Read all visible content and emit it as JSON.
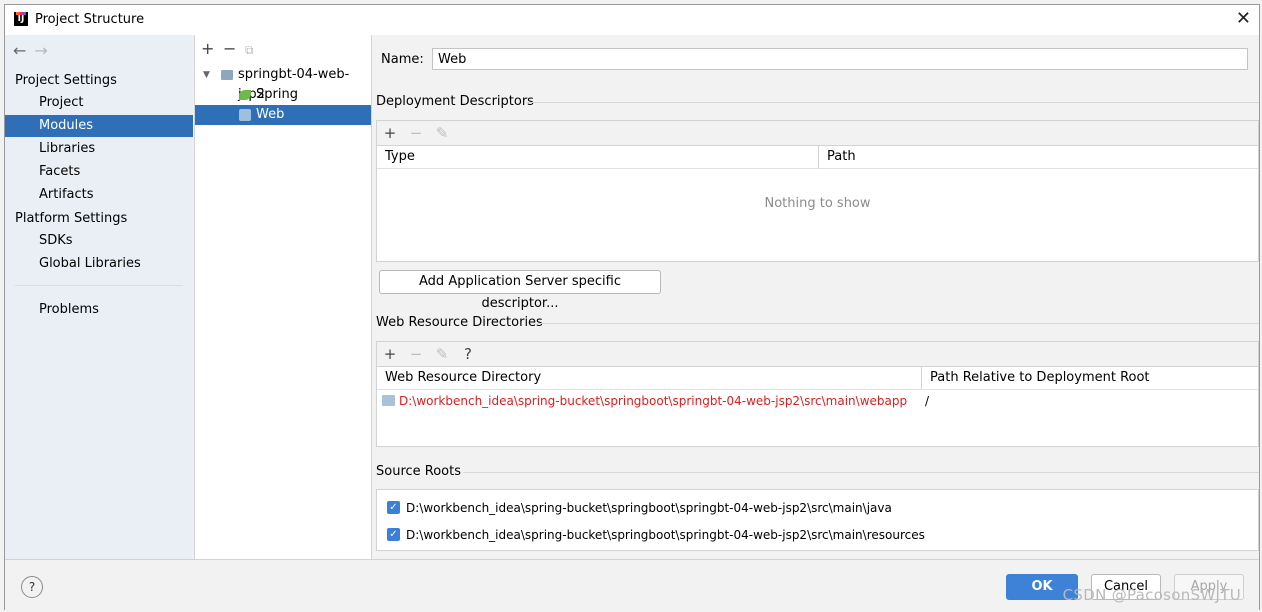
{
  "window": {
    "title": "Project Structure",
    "app_icon_text": "IJ"
  },
  "nav": {
    "back_arrow": "←",
    "forward_arrow": "→",
    "project_settings_header": "Project Settings",
    "project_items": [
      "Project",
      "Modules",
      "Libraries",
      "Facets",
      "Artifacts"
    ],
    "selected_item": "Modules",
    "platform_settings_header": "Platform Settings",
    "platform_items": [
      "SDKs",
      "Global Libraries"
    ],
    "problems_label": "Problems"
  },
  "tree": {
    "toolbar": [
      "+",
      "−",
      "⧉"
    ],
    "root": "springbt-04-web-jsp2",
    "children": [
      "Spring",
      "Web"
    ],
    "selected": "Web"
  },
  "main": {
    "name_label": "Name:",
    "name_value": "Web",
    "deployment_descriptors": {
      "title": "Deployment Descriptors",
      "toolbar": [
        "+",
        "−",
        "✎"
      ],
      "columns": [
        "Type",
        "Path"
      ],
      "empty_message": "Nothing to show",
      "add_button": "Add Application Server specific descriptor..."
    },
    "web_resource_directories": {
      "title": "Web Resource Directories",
      "toolbar": [
        "+",
        "−",
        "✎",
        "?"
      ],
      "columns": [
        "Web Resource Directory",
        "Path Relative to Deployment Root"
      ],
      "rows": [
        {
          "directory": "D:\\workbench_idea\\spring-bucket\\springboot\\springbt-04-web-jsp2\\src\\main\\webapp",
          "relative_path": "/"
        }
      ]
    },
    "source_roots": {
      "title": "Source Roots",
      "items": [
        {
          "checked": true,
          "path": "D:\\workbench_idea\\spring-bucket\\springboot\\springbt-04-web-jsp2\\src\\main\\java"
        },
        {
          "checked": true,
          "path": "D:\\workbench_idea\\spring-bucket\\springboot\\springbt-04-web-jsp2\\src\\main\\resources"
        }
      ]
    }
  },
  "footer": {
    "help": "?",
    "ok": "OK",
    "cancel": "Cancel",
    "apply": "Apply",
    "watermark": "CSDN @PacosonSWJTU"
  },
  "colors": {
    "selection": "#2f6fb8",
    "ok_button": "#3d82d6",
    "error_path": "#d42222"
  }
}
